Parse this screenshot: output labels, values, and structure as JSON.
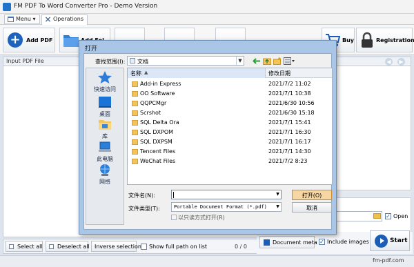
{
  "app": {
    "title": "FM PDF To Word Converter Pro - Demo Version",
    "menu_label": "Menu",
    "operations_tab": "Operations",
    "add_pdf_label": "Add PDF",
    "add_folder_label": "Add Fol",
    "buy_label": "Buy",
    "registration_label": "Registration",
    "input_header": "Input PDF File",
    "open_label": "Open",
    "select_all_label": "Select all",
    "deselect_all_label": "Deselect all",
    "invert_selection_label": "Inverse selection",
    "full_path_label": "Show full path on list",
    "file_count": "0 / 0",
    "document_meta_label": "Document meta",
    "include_images_label": "Include images",
    "start_label": "Start",
    "site": "fm-pdf.com"
  },
  "dialog": {
    "title": "打开",
    "lookin_label": "查找范围(I):",
    "lookin_value": "文档",
    "places": [
      "快速访问",
      "桌面",
      "库",
      "此电脑",
      "网络"
    ],
    "columns": {
      "name": "名称",
      "date": "修改日期"
    },
    "files": [
      {
        "name": "Add-in Express",
        "date": "2021/7/2 11:02"
      },
      {
        "name": "OO Software",
        "date": "2021/7/1 10:38"
      },
      {
        "name": "QQPCMgr",
        "date": "2021/6/30 10:56"
      },
      {
        "name": "Scrshot",
        "date": "2021/6/30 15:18"
      },
      {
        "name": "SQL Delta Ora",
        "date": "2021/7/1 15:41"
      },
      {
        "name": "SQL DXPOM",
        "date": "2021/7/1 16:30"
      },
      {
        "name": "SQL DXPSM",
        "date": "2021/7/1 16:17"
      },
      {
        "name": "Tencent Files",
        "date": "2021/7/1 14:30"
      },
      {
        "name": "WeChat Files",
        "date": "2021/7/2 8:23"
      }
    ],
    "filename_label": "文件名(N):",
    "filename_value": "",
    "filetype_label": "文件类型(T):",
    "filetype_value": "Portable Document Format (*.pdf)",
    "readonly_label": "以只读方式打开(R)",
    "open_button": "打开(O)",
    "cancel_button": "取消"
  },
  "colors": {
    "accent": "#1d63bd",
    "folder": "#f4c35a",
    "dialog_frame": "#a9c6e6"
  }
}
